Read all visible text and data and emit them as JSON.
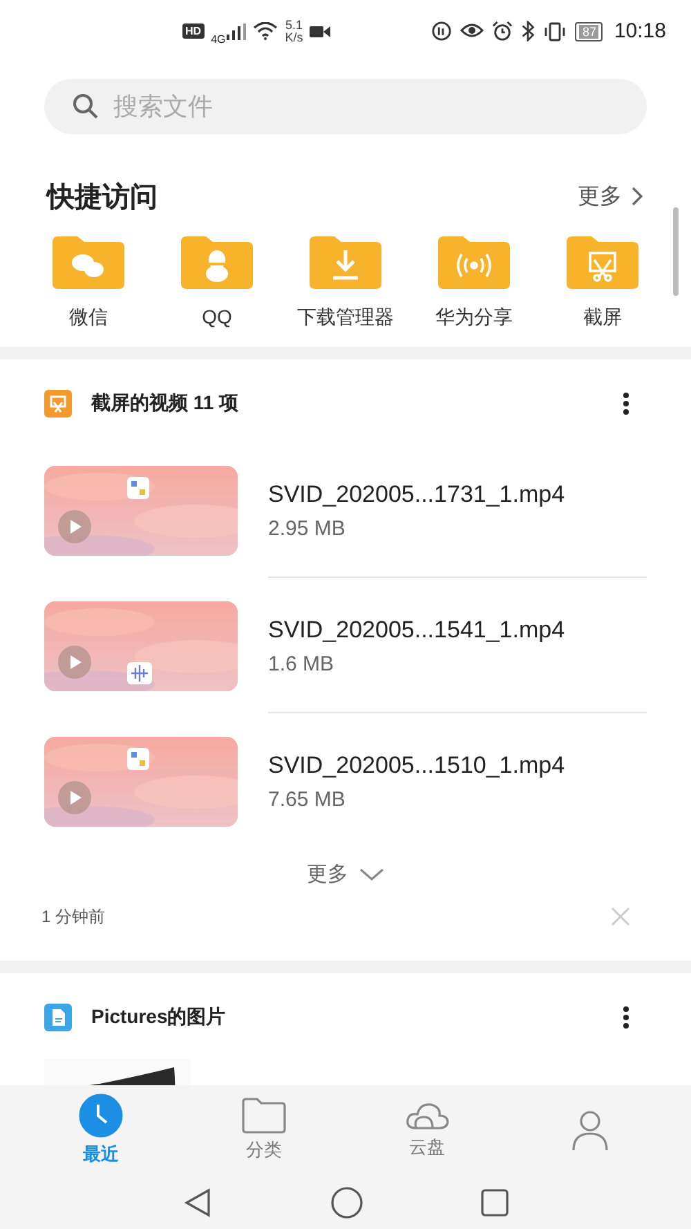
{
  "status_bar": {
    "hd": "HD",
    "network": "4G",
    "speed": "5.1",
    "speed_unit": "K/s",
    "battery": "87",
    "time": "10:18"
  },
  "search": {
    "placeholder": "搜索文件"
  },
  "quick_access": {
    "title": "快捷访问",
    "more": "更多",
    "items": [
      {
        "label": "微信",
        "kind": "chat"
      },
      {
        "label": "QQ",
        "kind": "penguin"
      },
      {
        "label": "下载管理器",
        "kind": "download"
      },
      {
        "label": "华为分享",
        "kind": "share"
      },
      {
        "label": "截屏",
        "kind": "screenshot"
      }
    ]
  },
  "video_group": {
    "title": "截屏的视频 11 项",
    "files": [
      {
        "name": "SVID_202005...1731_1.mp4",
        "size": "2.95 MB"
      },
      {
        "name": "SVID_202005...1541_1.mp4",
        "size": "1.6 MB"
      },
      {
        "name": "SVID_202005...1510_1.mp4",
        "size": "7.65 MB"
      }
    ],
    "more": "更多",
    "time": "1 分钟前"
  },
  "picture_group": {
    "title": "Pictures的图片"
  },
  "bottom_nav": [
    {
      "label": "最近",
      "kind": "clock",
      "selected": true
    },
    {
      "label": "分类",
      "kind": "folder",
      "selected": false
    },
    {
      "label": "云盘",
      "kind": "cloud",
      "selected": false
    },
    {
      "kind": "person",
      "selected": false
    }
  ]
}
